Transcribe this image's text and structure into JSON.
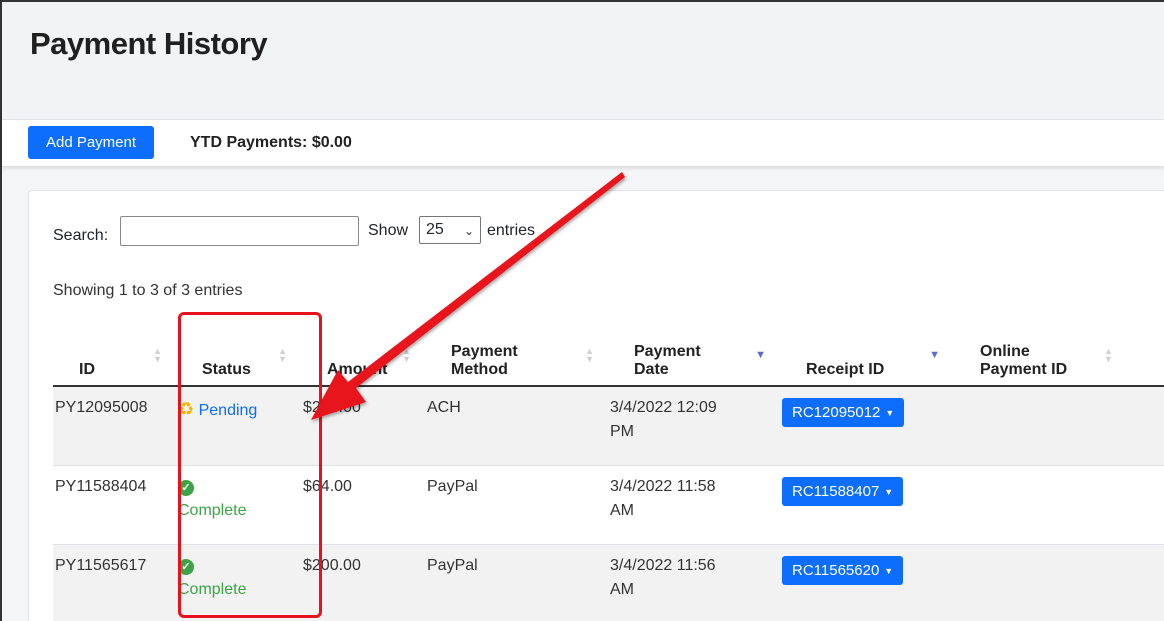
{
  "page": {
    "title": "Payment History"
  },
  "toolbar": {
    "add_label": "Add Payment",
    "ytd_text": "YTD Payments: $0.00"
  },
  "controls": {
    "search_label": "Search:",
    "search_value": "",
    "show_label": "Show",
    "entries_value": "25",
    "entries_label": "entries",
    "info": "Showing 1 to 3 of 3 entries"
  },
  "table": {
    "headers": {
      "id": "ID",
      "status": "Status",
      "amount": "Amount",
      "method_1": "Payment",
      "method_2": "Method",
      "date_1": "Payment",
      "date_2": "Date",
      "receipt": "Receipt ID",
      "online_1": "Online",
      "online_2": "Payment ID"
    },
    "rows": [
      {
        "id": "PY12095008",
        "status": "Pending",
        "amount": "$264.00",
        "method": "ACH",
        "date_1": "3/4/2022 12:09",
        "date_2": "PM",
        "receipt": "RC12095012",
        "online": ""
      },
      {
        "id": "PY11588404",
        "status": "Complete",
        "amount": "$64.00",
        "method": "PayPal",
        "date_1": "3/4/2022 11:58",
        "date_2": "AM",
        "receipt": "RC11588407",
        "online": ""
      },
      {
        "id": "PY11565617",
        "status": "Complete",
        "amount": "$200.00",
        "method": "PayPal",
        "date_1": "3/4/2022 11:56",
        "date_2": "AM",
        "receipt": "RC11565620",
        "online": ""
      }
    ]
  },
  "colors": {
    "primary": "#0d6efd",
    "pending": "#0d6efd",
    "complete": "#3ca447",
    "pending_icon": "#f4b400",
    "annotation": "#e8121c"
  },
  "icons": {
    "pending": "recycle-icon",
    "complete": "check-circle-icon",
    "caret": "caret-down-icon",
    "select_chevron": "chevron-down-icon"
  }
}
